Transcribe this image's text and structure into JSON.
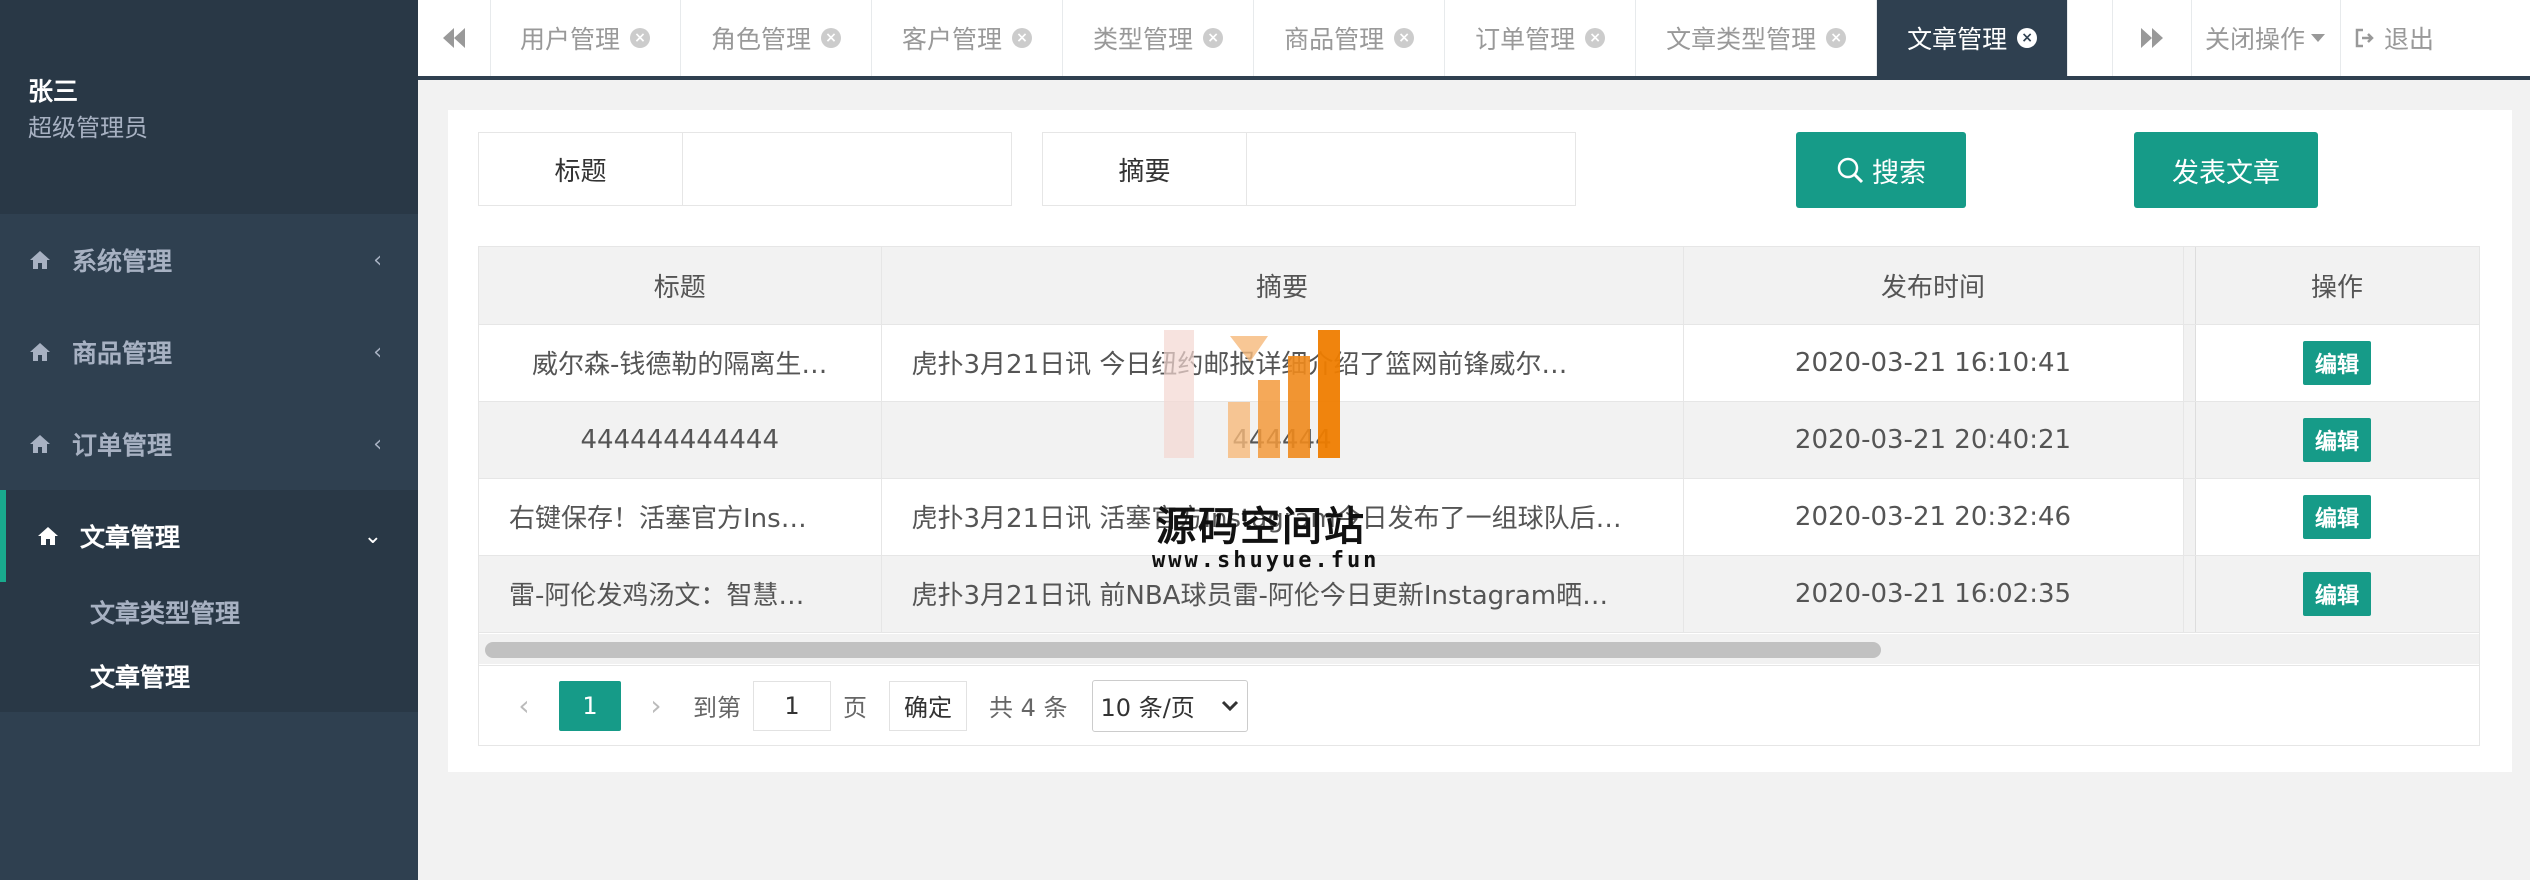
{
  "profile": {
    "name": "张三",
    "role": "超级管理员"
  },
  "menu": [
    {
      "label": "系统管理",
      "arrow": "‹"
    },
    {
      "label": "商品管理",
      "arrow": "‹"
    },
    {
      "label": "订单管理",
      "arrow": "‹"
    },
    {
      "label": "文章管理",
      "arrow": "⌄"
    }
  ],
  "submenu": [
    {
      "label": "文章类型管理"
    },
    {
      "label": "文章管理"
    }
  ],
  "tabs": [
    {
      "label": "用户管理"
    },
    {
      "label": "角色管理"
    },
    {
      "label": "客户管理"
    },
    {
      "label": "类型管理"
    },
    {
      "label": "商品管理"
    },
    {
      "label": "订单管理"
    },
    {
      "label": "文章类型管理"
    },
    {
      "label": "文章管理"
    }
  ],
  "toolbar": {
    "close_ops": "关闭操作",
    "logout": "退出"
  },
  "search": {
    "title_label": "标题",
    "title_value": "",
    "summary_label": "摘要",
    "summary_value": "",
    "search_button": "搜索",
    "publish_button": "发表文章"
  },
  "table": {
    "headers": [
      "标题",
      "摘要",
      "发布时间",
      "操作"
    ],
    "rows": [
      {
        "title": "威尔森-钱德勒的隔离生…",
        "summary": "虎扑3月21日讯 今日纽约邮报详细介绍了篮网前锋威尔…",
        "time": "2020-03-21 16:10:41",
        "action": "编辑"
      },
      {
        "title": "444444444444",
        "summary": "444444",
        "time": "2020-03-21 20:40:21",
        "action": "编辑"
      },
      {
        "title": "右键保存！活塞官方Ins…",
        "summary": "虎扑3月21日讯 活塞官方Instagram今日发布了一组球队后…",
        "time": "2020-03-21 20:32:46",
        "action": "编辑"
      },
      {
        "title": "雷-阿伦发鸡汤文：智慧…",
        "summary": "虎扑3月21日讯 前NBA球员雷-阿伦今日更新Instagram晒…",
        "time": "2020-03-21 16:02:35",
        "action": "编辑"
      }
    ]
  },
  "pagination": {
    "prev": "‹",
    "current": "1",
    "next": "›",
    "goto_label": "到第",
    "goto_value": "1",
    "page_unit": "页",
    "confirm": "确定",
    "total": "共 4 条",
    "page_size": "10 条/页"
  },
  "watermark": {
    "text": "源码空间站",
    "url": "www.shuyue.fun"
  },
  "colors": {
    "sidebar": "#2f4050",
    "accent": "#169b88",
    "active_tab": "#2f4050"
  }
}
